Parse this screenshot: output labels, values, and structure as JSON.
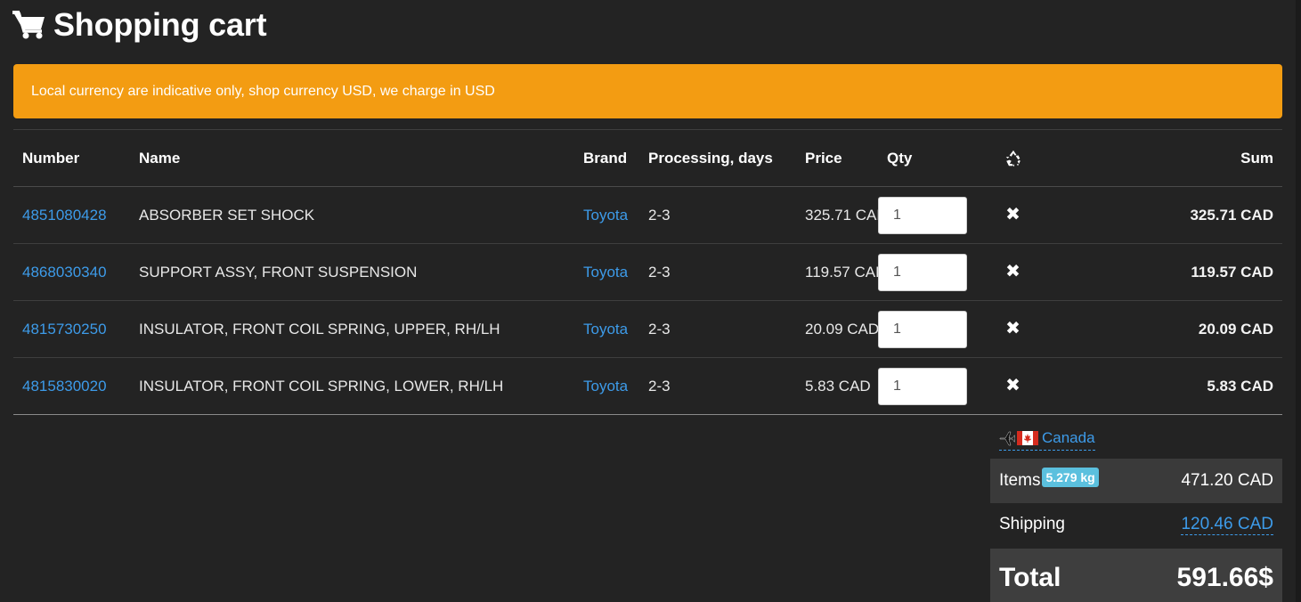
{
  "header": {
    "title": "Shopping cart",
    "icon": "shopping-cart-icon"
  },
  "alert": {
    "message": "Local currency are indicative only, shop currency USD, we charge in USD",
    "color": "#f39c12"
  },
  "table": {
    "columns": {
      "number": "Number",
      "name": "Name",
      "brand": "Brand",
      "processing": "Processing, days",
      "price": "Price",
      "qty": "Qty",
      "remove": "recycle-icon",
      "sum": "Sum"
    },
    "rows": [
      {
        "number": "4851080428",
        "name": "ABSORBER SET SHOCK",
        "brand": "Toyota",
        "processing": "2-3",
        "price": "325.71 CAD",
        "qty": "1",
        "sum": "325.71 CAD"
      },
      {
        "number": "4868030340",
        "name": "SUPPORT ASSY, FRONT SUSPENSION",
        "brand": "Toyota",
        "processing": "2-3",
        "price": "119.57 CAD",
        "qty": "1",
        "sum": "119.57 CAD"
      },
      {
        "number": "4815730250",
        "name": "INSULATOR, FRONT COIL SPRING, UPPER, RH/LH",
        "brand": "Toyota",
        "processing": "2-3",
        "price": "20.09 CAD",
        "qty": "1",
        "sum": "20.09 CAD"
      },
      {
        "number": "4815830020",
        "name": "INSULATOR, FRONT COIL SPRING, LOWER, RH/LH",
        "brand": "Toyota",
        "processing": "2-3",
        "price": "5.83 CAD",
        "qty": "1",
        "sum": "5.83 CAD"
      }
    ]
  },
  "destination": {
    "country": "Canada",
    "icons": [
      "airplane-icon",
      "canada-flag-icon"
    ]
  },
  "summary": {
    "items_label": "Items",
    "weight": "5.279 kg",
    "items_value": "471.20 CAD",
    "shipping_label": "Shipping",
    "shipping_value": "120.46 CAD",
    "total_label": "Total",
    "total_value": "591.66$"
  },
  "colors": {
    "background": "#232323",
    "link": "#3d9be9",
    "badge": "#5bc0de",
    "alert": "#f39c12"
  }
}
